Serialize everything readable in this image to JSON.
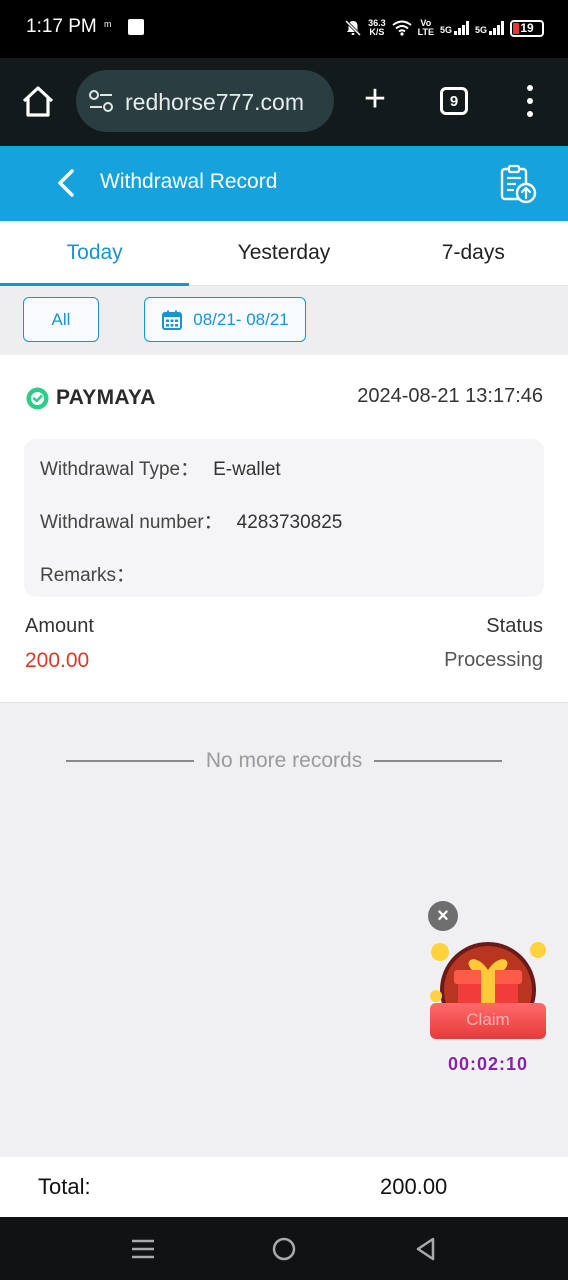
{
  "status_bar": {
    "time": "1:17 PM",
    "notif_glyph": "ᵐ",
    "net_speed_value": "36.3",
    "net_speed_unit": "K/S",
    "volte_top": "Vo",
    "volte_bottom": "LTE",
    "signal1_label": "5G",
    "signal2_label": "5G",
    "battery": "19",
    "battery_color": "#e53935",
    "icons": [
      "mute-bell-icon",
      "wifi-icon",
      "signal-icon",
      "battery-icon"
    ]
  },
  "browser": {
    "url": "redhorse777.com",
    "tab_count": "9",
    "plus": "+"
  },
  "header": {
    "title": "Withdrawal Record",
    "accent": "#16a2dc"
  },
  "tabs": [
    {
      "label": "Today",
      "active": true
    },
    {
      "label": "Yesterday",
      "active": false
    },
    {
      "label": "7-days",
      "active": false
    }
  ],
  "filter": {
    "all_label": "All",
    "date_range": "08/21- 08/21"
  },
  "record": {
    "provider": "PAYMAYA",
    "datetime": "2024-08-21 13:17:46",
    "withdrawal_type_label": "Withdrawal Type：",
    "withdrawal_type_value": "E-wallet",
    "withdrawal_number_label": "Withdrawal number：",
    "withdrawal_number_value": "4283730825",
    "remarks_label": "Remarks：",
    "amount_label": "Amount",
    "amount_value": "200.00",
    "status_label": "Status",
    "status_value": "Processing",
    "amount_color": "#d93a26"
  },
  "list_end": {
    "text": "No more records"
  },
  "float_widget": {
    "close": "×",
    "claim_label": "Claim",
    "timer": "00:02:10"
  },
  "footer": {
    "total_label": "Total:",
    "total_value": "200.00"
  }
}
